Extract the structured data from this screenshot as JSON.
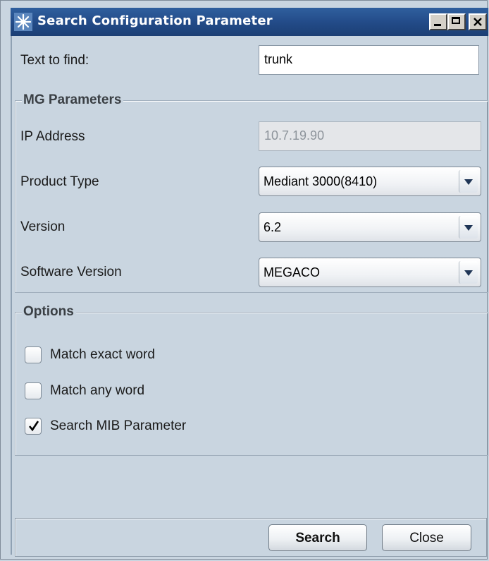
{
  "window": {
    "title": "Search Configuration Parameter",
    "icon": "snowflake-app-icon",
    "controls": [
      "minimize-icon",
      "maximize-icon",
      "close-icon"
    ]
  },
  "search": {
    "label": "Text to find:",
    "value": "trunk"
  },
  "mg_parameters": {
    "title": "MG Parameters",
    "ip_address": {
      "label": "IP Address",
      "value": "10.7.19.90"
    },
    "product_type": {
      "label": "Product Type",
      "value": "Mediant 3000(8410)"
    },
    "version": {
      "label": "Version",
      "value": "6.2"
    },
    "software_version": {
      "label": "Software Version",
      "value": "MEGACO"
    }
  },
  "options": {
    "title": "Options",
    "items": [
      {
        "label": "Match exact word",
        "checked": false
      },
      {
        "label": "Match any word",
        "checked": false
      },
      {
        "label": "Search MIB Parameter",
        "checked": true
      }
    ]
  },
  "buttons": {
    "search": "Search",
    "close": "Close"
  },
  "colors": {
    "titlebar": "#224a87",
    "background": "#c9d5e0",
    "disabled_field": "#e4e6e9"
  }
}
